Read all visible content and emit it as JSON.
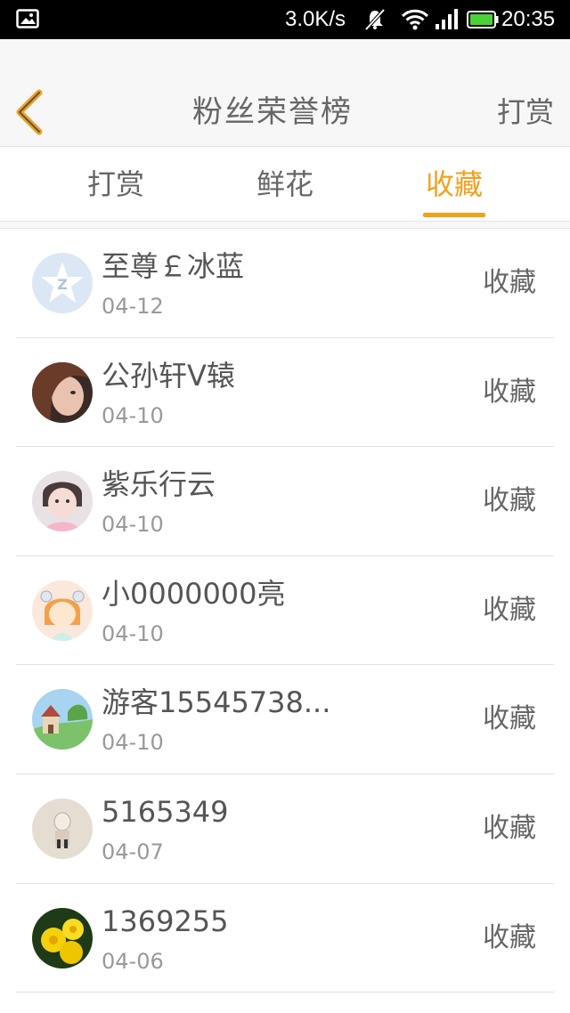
{
  "status_bar": {
    "net_speed": "3.0K/s",
    "time": "20:35",
    "icons": [
      "gallery-icon",
      "mute-icon",
      "wifi-icon",
      "signal-icon",
      "battery-icon"
    ],
    "battery_color": "#4cd137"
  },
  "header": {
    "title": "粉丝荣誉榜",
    "back_icon": "chevron-left-icon",
    "action_label": "打赏"
  },
  "tabs": [
    {
      "label": "打赏",
      "selected": false
    },
    {
      "label": "鲜花",
      "selected": false
    },
    {
      "label": "收藏",
      "selected": true
    }
  ],
  "accent_color": "#f2a11d",
  "fans": [
    {
      "name": "至尊￡冰蓝",
      "date": "04-12",
      "action": "收藏",
      "avatar": "default-star-avatar"
    },
    {
      "name": "公孙轩V辕",
      "date": "04-10",
      "action": "收藏",
      "avatar": "photo-avatar"
    },
    {
      "name": "紫乐行云",
      "date": "04-10",
      "action": "收藏",
      "avatar": "photo-avatar"
    },
    {
      "name": "小0000000亮",
      "date": "04-10",
      "action": "收藏",
      "avatar": "cartoon-avatar"
    },
    {
      "name": "游客15545738...",
      "date": "04-10",
      "action": "收藏",
      "avatar": "landscape-avatar"
    },
    {
      "name": "5165349",
      "date": "04-07",
      "action": "收藏",
      "avatar": "photo-avatar"
    },
    {
      "name": "1369255",
      "date": "04-06",
      "action": "收藏",
      "avatar": "flower-avatar"
    }
  ]
}
